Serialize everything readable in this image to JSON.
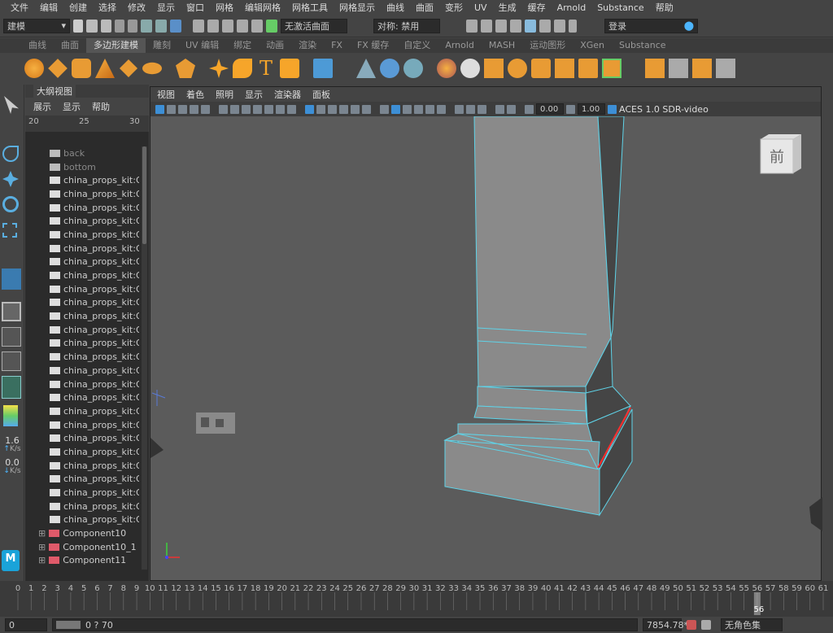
{
  "menubar": [
    "文件",
    "编辑",
    "创建",
    "选择",
    "修改",
    "显示",
    "窗口",
    "网格",
    "编辑网格",
    "网格工具",
    "网格显示",
    "曲线",
    "曲面",
    "变形",
    "UV",
    "生成",
    "缓存",
    "Arnold",
    "Substance",
    "帮助"
  ],
  "statusline": {
    "mode": "建模",
    "live_surface": "无激活曲面",
    "symmetry": "对称: 禁用",
    "login": "登录"
  },
  "shelf_tabs": [
    "曲线",
    "曲面",
    "多边形建模",
    "雕刻",
    "UV 编辑",
    "绑定",
    "动画",
    "渲染",
    "FX",
    "FX 缓存",
    "自定义",
    "Arnold",
    "MASH",
    "运动图形",
    "XGen",
    "Substance"
  ],
  "shelf_active": "多边形建模",
  "leftbar": {
    "rate1": "1.6",
    "unit1": "K/s",
    "rate2": "0.0",
    "unit2": "K/s",
    "logo": "M"
  },
  "outliner": {
    "title": "大纲视图",
    "menu": [
      "展示",
      "显示",
      "帮助"
    ],
    "ruler": [
      "20",
      "25",
      "30"
    ],
    "camera_items": [
      "back",
      "bottom"
    ],
    "group_item_label": "china_props_kit:Gro",
    "group_count": 26,
    "components": [
      "Component10",
      "Component10_1",
      "Component11"
    ]
  },
  "viewport": {
    "menu": [
      "视图",
      "着色",
      "照明",
      "显示",
      "渲染器",
      "面板"
    ],
    "exposure": "0.00",
    "gamma": "1.00",
    "colorspace": "ACES 1.0 SDR-video",
    "viewcube_label": "前",
    "colors": {
      "bg": "#5b5b5b",
      "wire": "#5fd3e8",
      "selected_edge": "#ff2b2b"
    }
  },
  "timeline": {
    "ticks_start": 0,
    "ticks_end": 61,
    "current_frame": "56"
  },
  "bottombar": {
    "start_frame": "0",
    "range_text": "0 ? 70",
    "value": "7854.78*",
    "char_set": "无角色集"
  }
}
